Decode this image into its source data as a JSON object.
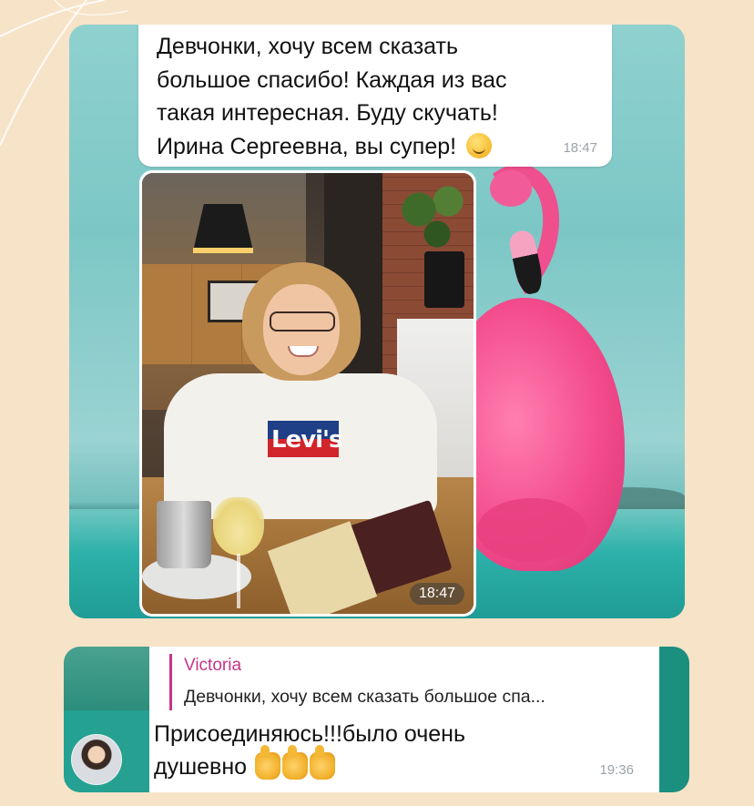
{
  "top_message": {
    "lines": [
      "Девчонки, хочу всем сказать",
      "большое спасибо! Каждая из вас",
      "такая интересная. Буду скучать!",
      "Ирина Сергеевна, вы супер!"
    ],
    "emoji": "smiling-face-emoji",
    "time": "18:47"
  },
  "photo_message": {
    "time": "18:47",
    "logo_text": "Levi's"
  },
  "reply_message": {
    "quoted_author": "Victoria",
    "quoted_text": "Девчонки, хочу всем сказать большое спа...",
    "text_line1": "Присоединяюсь!!!было очень",
    "text_line2": "душевно",
    "emojis": [
      "thumbs-up-icon",
      "thumbs-up-icon",
      "thumbs-up-icon"
    ],
    "time": "19:36"
  },
  "colors": {
    "page_background": "#f7e3c8",
    "reply_accent": "#c7348a",
    "timestamp": "#9aa2a9"
  }
}
